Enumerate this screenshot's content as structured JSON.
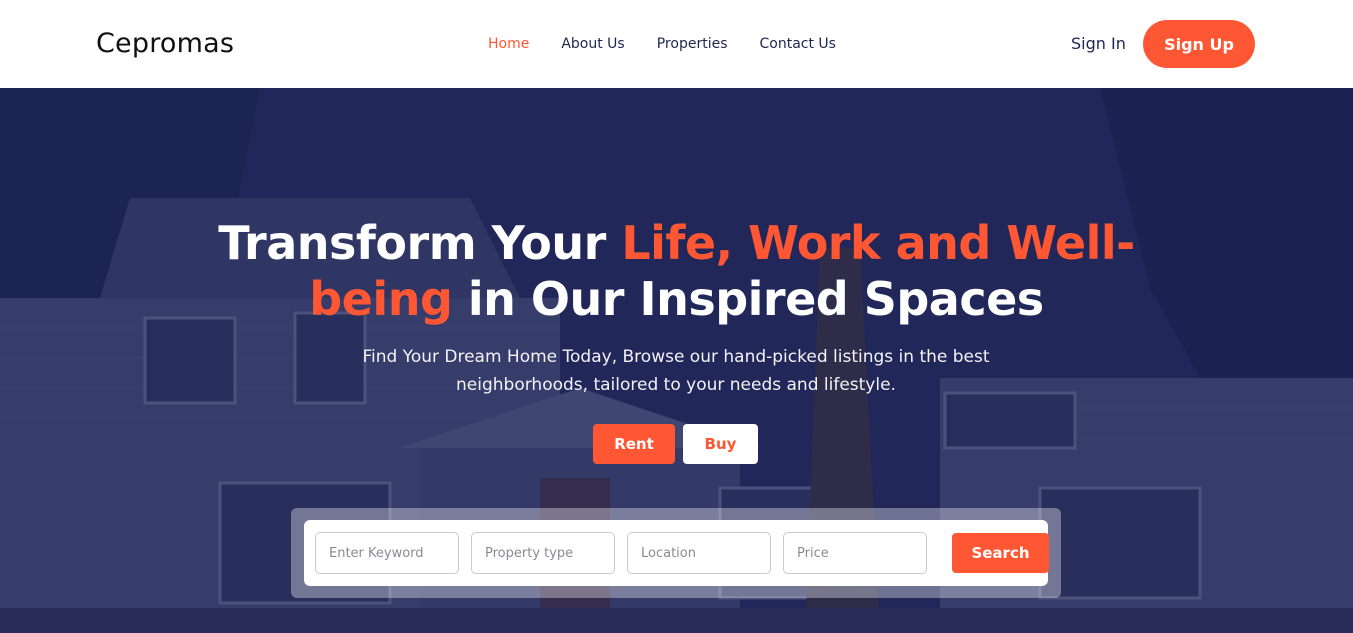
{
  "brand": {
    "name": "Cepromas"
  },
  "nav": {
    "items": [
      {
        "label": "Home",
        "active": true
      },
      {
        "label": "About Us",
        "active": false
      },
      {
        "label": "Properties",
        "active": false
      },
      {
        "label": "Contact Us",
        "active": false
      }
    ]
  },
  "auth": {
    "sign_in": "Sign In",
    "sign_up": "Sign Up"
  },
  "hero": {
    "headline_part1": "Transform Your ",
    "headline_accent1": "Life, Work and Well-",
    "headline_accent2": "being",
    "headline_part2": " in Our Inspired Spaces",
    "subtext_line1": "Find Your Dream Home Today, Browse our hand-picked listings in the best",
    "subtext_line2": "neighborhoods, tailored to your needs and lifestyle.",
    "toggle": {
      "rent": "Rent",
      "buy": "Buy",
      "selected": "Rent"
    }
  },
  "search": {
    "keyword_placeholder": "Enter Keyword",
    "property_type_placeholder": "Property type",
    "location_placeholder": "Location",
    "price_placeholder": "Price",
    "button_label": "Search"
  },
  "colors": {
    "accent": "#ff5733",
    "nav_text": "#1f2550",
    "hero_overlay": "#1a2052"
  }
}
